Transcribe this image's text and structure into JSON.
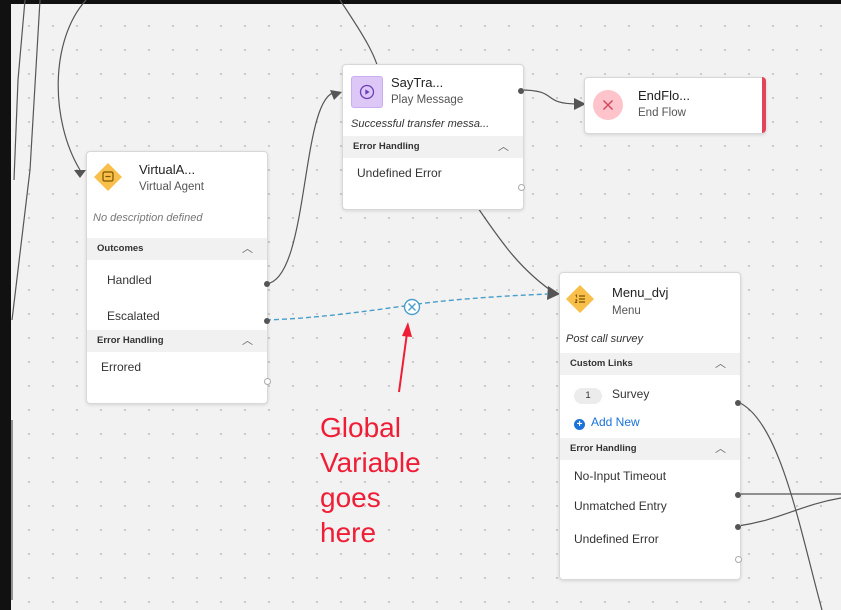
{
  "nodes": {
    "say": {
      "title": "SayTra...",
      "subtitle": "Play Message",
      "description": "Successful transfer messa...",
      "error_section": "Error Handling",
      "error_rows": [
        "Undefined Error"
      ]
    },
    "end": {
      "title": "EndFlo...",
      "subtitle": "End Flow"
    },
    "virtual": {
      "title": "VirtualA...",
      "subtitle": "Virtual Agent",
      "description": "No description defined",
      "outcomes_section": "Outcomes",
      "outcomes": [
        "Handled",
        "Escalated"
      ],
      "error_section": "Error Handling",
      "error_rows": [
        "Errored"
      ]
    },
    "menu": {
      "title": "Menu_dvj",
      "subtitle": "Menu",
      "description": "Post call survey",
      "links_section": "Custom Links",
      "link_badge": "1",
      "link_label": "Survey",
      "add_new": "Add New",
      "error_section": "Error Handling",
      "error_rows": [
        "No-Input Timeout",
        "Unmatched Entry",
        "Undefined Error"
      ]
    }
  },
  "annotation": {
    "lines": [
      "Global",
      "Variable",
      "goes",
      "here"
    ],
    "color": "#ef1e36"
  },
  "colors": {
    "accent": "#1a73d9",
    "end_bar": "#e2455a",
    "menu_icon": "#f8c04a",
    "play_icon": "#dcc7f7",
    "end_icon": "#ffc4cb",
    "dashed_link": "#4a9ec9"
  }
}
